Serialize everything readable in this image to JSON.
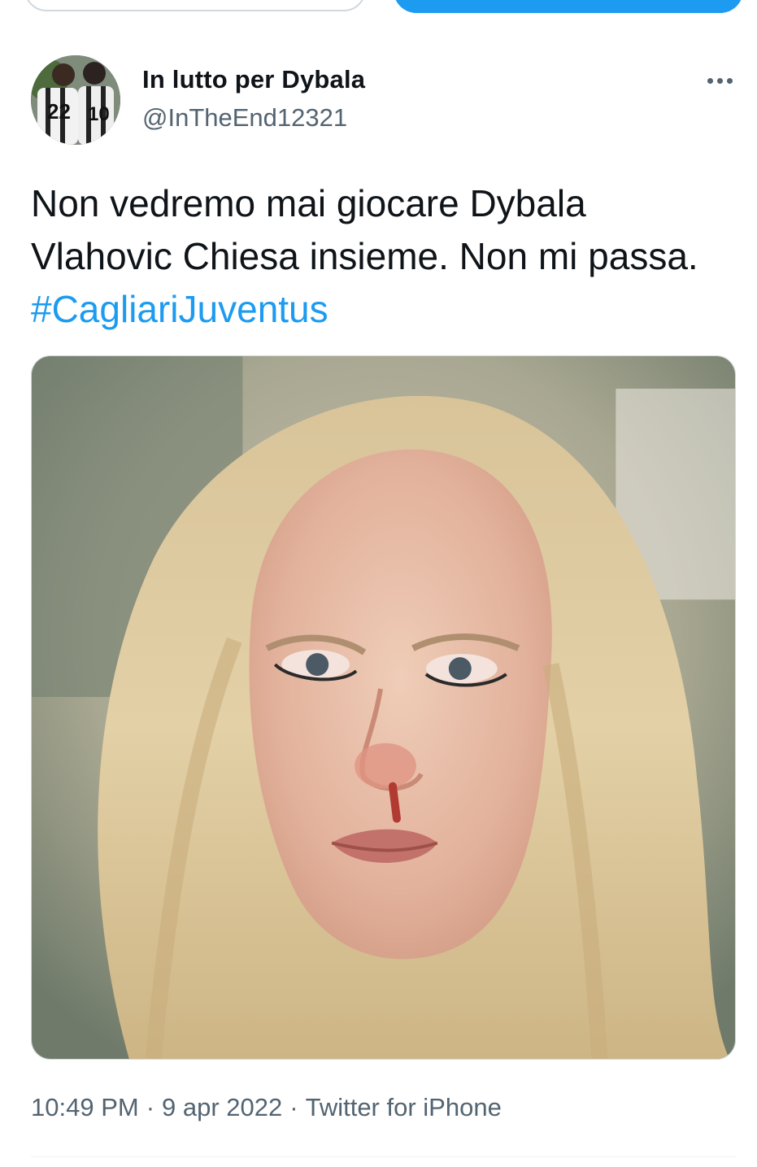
{
  "author": {
    "display_name": "In lutto per Dybala",
    "handle": "@InTheEnd12321",
    "avatar_jersey_numbers": [
      "22",
      "10"
    ]
  },
  "tweet": {
    "text": "Non vedremo mai giocare Dybala Vlahovic Chiesa insieme. Non mi passa. ",
    "hashtag": "#CagliariJuventus"
  },
  "meta": {
    "time": "10:49 PM",
    "separator": "·",
    "date": "9 apr 2022",
    "source": "Twitter for iPhone"
  },
  "colors": {
    "accent": "#1d9bf0",
    "text": "#0f1419",
    "secondary_text": "#536471",
    "border": "#cfd9de"
  },
  "icons": {
    "more": "more-horizontal-icon"
  }
}
